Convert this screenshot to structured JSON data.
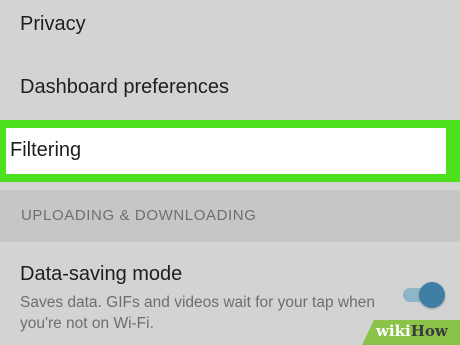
{
  "settings": {
    "privacy_label": "Privacy",
    "dashboard_label": "Dashboard preferences",
    "filtering_label": "Filtering",
    "section_header": "UPLOADING & DOWNLOADING",
    "data_saving": {
      "title": "Data-saving mode",
      "description": "Saves data. GIFs and videos wait for your tap when you're not on Wi-Fi.",
      "enabled": true
    }
  },
  "watermark": {
    "part1": "wiki",
    "part2": "How"
  },
  "colors": {
    "background": "#d3d3d3",
    "highlight": "#4de01f",
    "section_header_bg": "#c6c6c6",
    "toggle_thumb": "#3f7fa3",
    "toggle_track": "#8fb5c6",
    "watermark_leaf": "#8bc34a"
  }
}
